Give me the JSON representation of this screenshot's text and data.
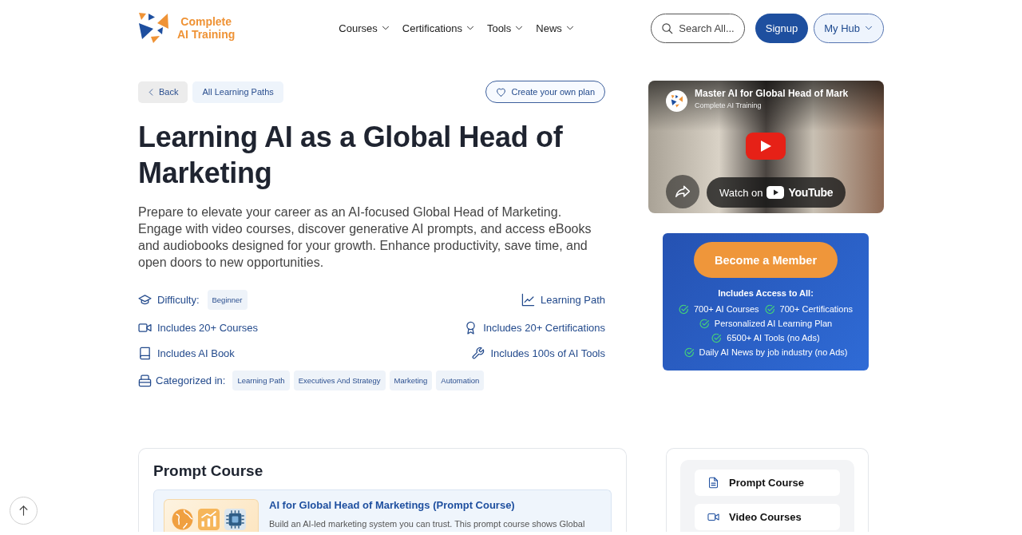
{
  "header": {
    "logo": {
      "line_1": "Complete",
      "line_2": "AI Training"
    },
    "nav": [
      {
        "label": "Courses"
      },
      {
        "label": "Certifications"
      },
      {
        "label": "Tools"
      },
      {
        "label": "News"
      }
    ],
    "search": {
      "label": "Search All..."
    },
    "signup": "Signup",
    "hub": "My Hub"
  },
  "toolbar": {
    "back": "Back",
    "breadcrumb": "All Learning Paths",
    "plan": "Create your own plan"
  },
  "hero": {
    "title": "Learning AI as a Global Head of Marketing",
    "description": "Prepare to elevate your career as an AI-focused Global Head of Marketing. Engage with video courses, discover generative AI prompts, and access eBooks and audiobooks designed for your growth. Enhance productivity, save time, and open doors to new opportunities."
  },
  "meta": {
    "difficulty_label": "Difficulty:",
    "difficulty": "Beginner",
    "path_type": "Learning Path",
    "includes": [
      "Includes 20+ Courses",
      "Includes 20+ Certifications",
      "Includes AI Book",
      "Includes 100s of AI Tools"
    ],
    "category_label": "Categorized in:",
    "categories": [
      "Learning Path",
      "Executives And Strategy",
      "Marketing",
      "Automation"
    ]
  },
  "video": {
    "title": "Master AI for Global Head of Mark",
    "channel": "Complete AI Training",
    "watch_label": "Watch on",
    "brand": "YouTube"
  },
  "membership": {
    "button": "Become a Member",
    "heading": "Includes Access to All:",
    "features": [
      "700+ AI Courses",
      "700+ Certifications",
      "Personalized AI Learning Plan",
      "6500+ AI Tools (no Ads)",
      "Daily AI News by job industry (no Ads)"
    ]
  },
  "prompt_course": {
    "heading": "Prompt Course",
    "items": [
      {
        "title": "AI for Global Head of Marketings (Prompt Course)",
        "description": "Build an AI-led marketing system you can trust. This prompt course shows Global"
      }
    ]
  },
  "section_nav": {
    "items": [
      {
        "label": "Prompt Course"
      },
      {
        "label": "Video Courses"
      }
    ]
  }
}
